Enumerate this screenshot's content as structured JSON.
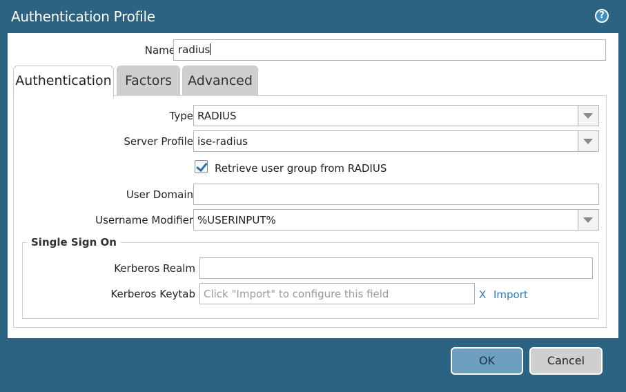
{
  "window": {
    "title": "Authentication Profile",
    "help_icon": "help-icon"
  },
  "name": {
    "label": "Name",
    "value": "radius"
  },
  "tabs": [
    {
      "label": "Authentication",
      "active": true
    },
    {
      "label": "Factors",
      "active": false
    },
    {
      "label": "Advanced",
      "active": false
    }
  ],
  "authentication": {
    "type": {
      "label": "Type",
      "value": "RADIUS"
    },
    "server_profile": {
      "label": "Server Profile",
      "value": "ise-radius"
    },
    "retrieve_group": {
      "label": "Retrieve user group from RADIUS",
      "checked": true
    },
    "user_domain": {
      "label": "User Domain",
      "value": ""
    },
    "username_modifier": {
      "label": "Username Modifier",
      "value": "%USERINPUT%"
    }
  },
  "sso": {
    "legend": "Single Sign On",
    "kerberos_realm": {
      "label": "Kerberos Realm",
      "value": ""
    },
    "kerberos_keytab": {
      "label": "Kerberos Keytab",
      "placeholder": "Click \"Import\" to configure this field"
    },
    "clear_label": "X",
    "import_label": "Import"
  },
  "footer": {
    "ok_label": "OK",
    "cancel_label": "Cancel"
  },
  "colors": {
    "chrome": "#2c6382",
    "link": "#2b7bb9",
    "ok_button": "#6c9ec0"
  }
}
